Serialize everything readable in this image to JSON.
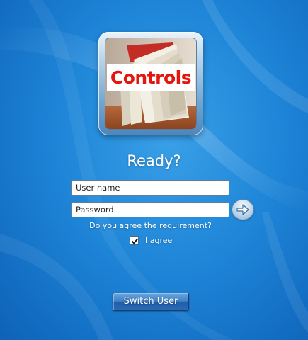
{
  "theme": {
    "background": "#1f86d8",
    "tile_text_color": "#e3170d",
    "button_blue": "#3f80c6"
  },
  "user_tile": {
    "image_label": "Controls",
    "image_icon": "book-photo"
  },
  "status_text": "Ready?",
  "login_form": {
    "username_placeholder": "User name",
    "username_value": "",
    "password_placeholder": "Password",
    "password_value": "",
    "submit_icon": "arrow-right-icon"
  },
  "agreement": {
    "question": "Do you agree the requirement?",
    "checkbox_label": "I agree",
    "checked": true
  },
  "switch_user_label": "Switch User"
}
